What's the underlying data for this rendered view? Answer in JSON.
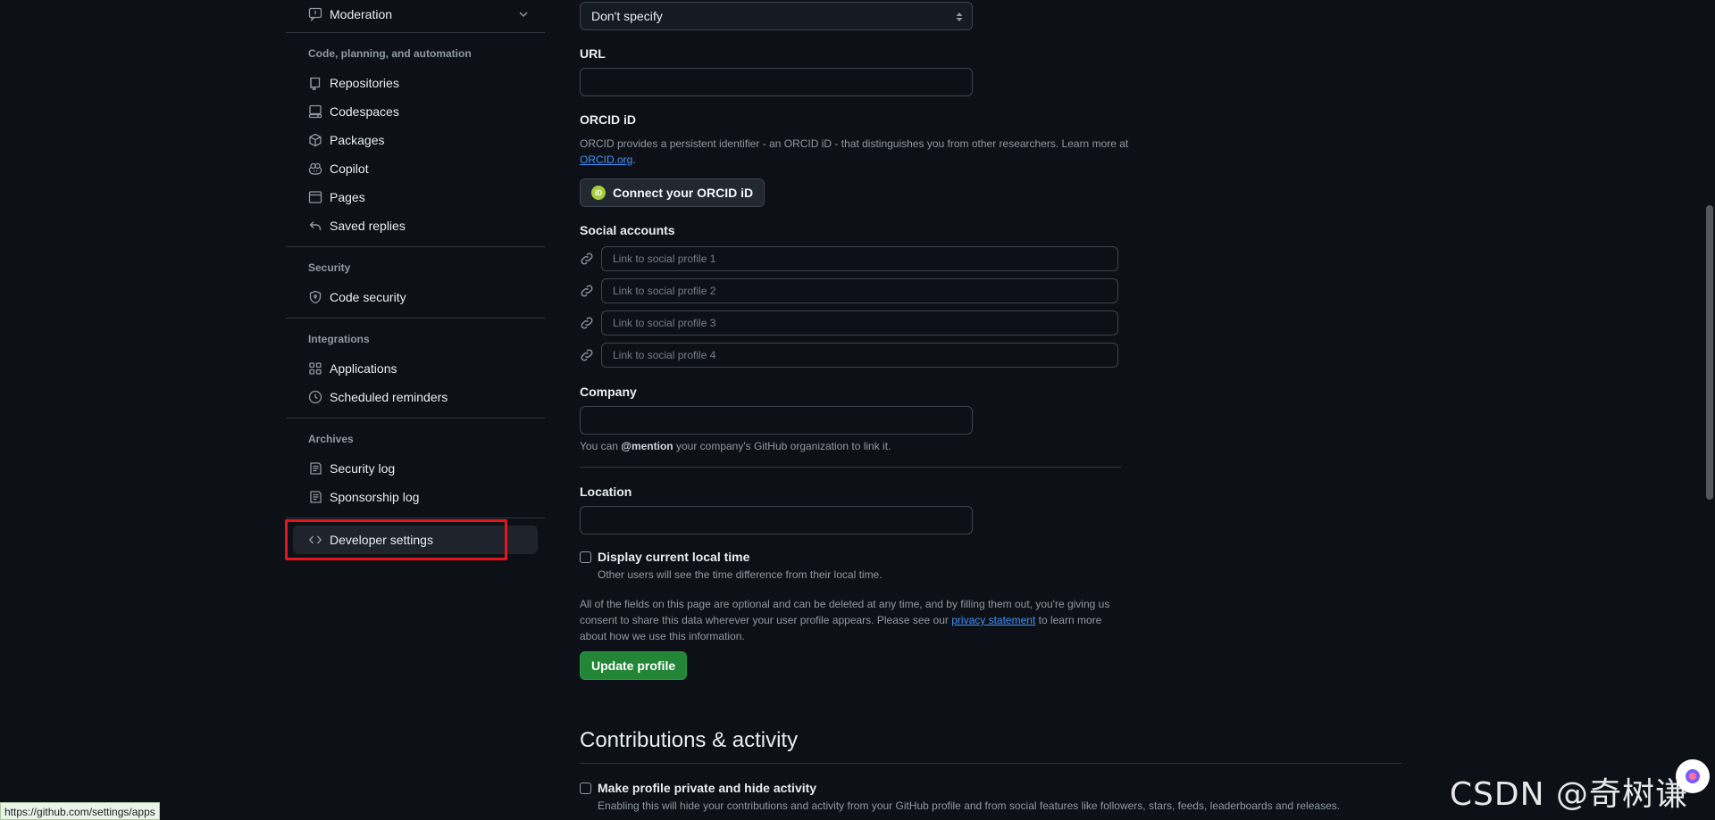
{
  "sidebar": {
    "moderation": {
      "label": "Moderation",
      "icon": "report-icon"
    },
    "groups": [
      {
        "heading": "Code, planning, and automation",
        "items": [
          {
            "label": "Repositories",
            "icon": "repo-icon"
          },
          {
            "label": "Codespaces",
            "icon": "codespaces-icon"
          },
          {
            "label": "Packages",
            "icon": "package-icon"
          },
          {
            "label": "Copilot",
            "icon": "copilot-icon"
          },
          {
            "label": "Pages",
            "icon": "browser-icon"
          },
          {
            "label": "Saved replies",
            "icon": "reply-icon"
          }
        ]
      },
      {
        "heading": "Security",
        "items": [
          {
            "label": "Code security",
            "icon": "shield-lock-icon"
          }
        ]
      },
      {
        "heading": "Integrations",
        "items": [
          {
            "label": "Applications",
            "icon": "apps-icon"
          },
          {
            "label": "Scheduled reminders",
            "icon": "clock-icon"
          }
        ]
      },
      {
        "heading": "Archives",
        "items": [
          {
            "label": "Security log",
            "icon": "log-icon"
          },
          {
            "label": "Sponsorship log",
            "icon": "log-icon"
          }
        ]
      }
    ],
    "developer_settings": {
      "label": "Developer settings",
      "icon": "code-icon"
    }
  },
  "form": {
    "pronouns_select": "Don't specify",
    "url": {
      "label": "URL",
      "value": ""
    },
    "orcid": {
      "label": "ORCID iD",
      "description": "ORCID provides a persistent identifier - an ORCID iD - that distinguishes you from other researchers. Learn more at",
      "link": "ORCID.org",
      "button": "Connect your ORCID iD",
      "badge": "iD"
    },
    "social": {
      "label": "Social accounts",
      "placeholders": [
        "Link to social profile 1",
        "Link to social profile 2",
        "Link to social profile 3",
        "Link to social profile 4"
      ]
    },
    "company": {
      "label": "Company",
      "value": "",
      "note_prefix": "You can ",
      "note_mention": "@mention",
      "note_suffix": " your company's GitHub organization to link it."
    },
    "location": {
      "label": "Location",
      "value": ""
    },
    "local_time": {
      "label": "Display current local time",
      "note": "Other users will see the time difference from their local time.",
      "checked": false
    },
    "consent": {
      "text_before": "All of the fields on this page are optional and can be deleted at any time, and by filling them out, you're giving us consent to share this data wherever your user profile appears. Please see our ",
      "link": "privacy statement",
      "text_after": " to learn more about how we use this information."
    },
    "update_button": "Update profile"
  },
  "contributions": {
    "title": "Contributions & activity",
    "private": {
      "label": "Make profile private and hide activity",
      "note": "Enabling this will hide your contributions and activity from your GitHub profile and from social features like followers, stars, feeds, leaderboards and releases.",
      "checked": false
    }
  },
  "status_bar": {
    "url": "https://github.com/settings/apps"
  },
  "watermark": "CSDN @奇树谦",
  "colors": {
    "background": "#0d1117",
    "border": "#3d444d",
    "primary_button": "#238636",
    "link": "#4493f8",
    "highlight": "#e5151b"
  }
}
